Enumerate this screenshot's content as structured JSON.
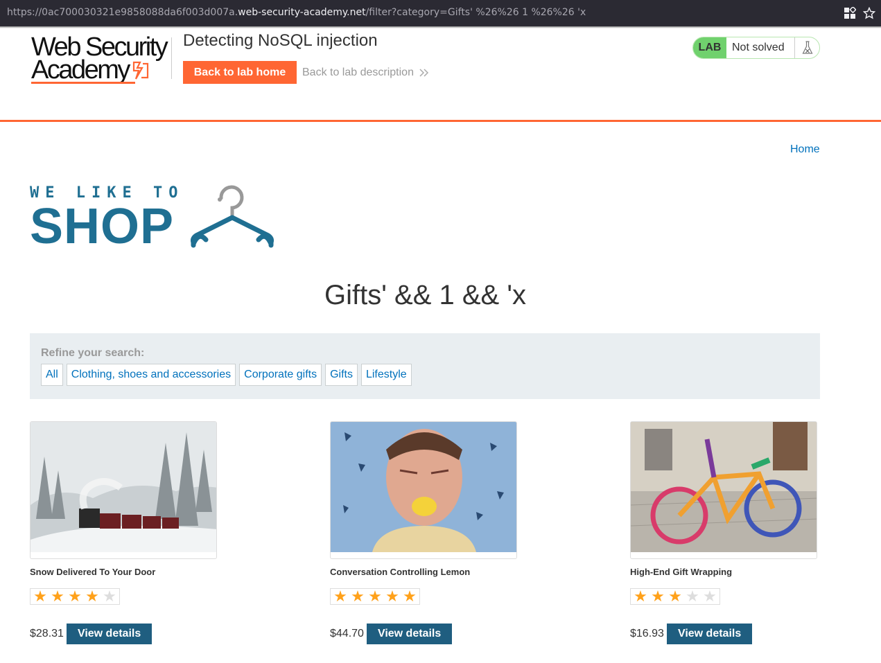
{
  "browser": {
    "url_prefix": "https://0ac700030321e9858088da6f003d007a.",
    "url_domain": "web-security-academy.net",
    "url_path": "/filter?category=Gifts' %26%26 1 %26%26 'x"
  },
  "lab_header": {
    "logo_line1": "Web Security",
    "logo_line2": "Academy",
    "title": "Detecting NoSQL injection",
    "back_home_label": "Back to lab home",
    "back_description_label": "Back to lab description",
    "status_tag": "LAB",
    "status_text": "Not solved"
  },
  "nav": {
    "home_label": "Home"
  },
  "shop_logo": {
    "small_text": "WE LIKE TO",
    "big_text": "SHOP"
  },
  "category_title": "Gifts' && 1 && 'x",
  "refine": {
    "label": "Refine your search:",
    "filters": [
      "All",
      "Clothing, shoes and accessories",
      "Corporate gifts",
      "Gifts",
      "Lifestyle"
    ]
  },
  "products": [
    {
      "name": "Snow Delivered To Your Door",
      "rating": 4,
      "price": "$28.31",
      "button": "View details"
    },
    {
      "name": "Conversation Controlling Lemon",
      "rating": 5,
      "price": "$44.70",
      "button": "View details"
    },
    {
      "name": "High-End Gift Wrapping",
      "rating": 3,
      "price": "$16.93",
      "button": "View details"
    }
  ],
  "colors": {
    "accent": "#ff6633",
    "link": "#0071bc",
    "brand": "#1f6f92",
    "button": "#1f5e80",
    "star": "#ffa11a"
  }
}
